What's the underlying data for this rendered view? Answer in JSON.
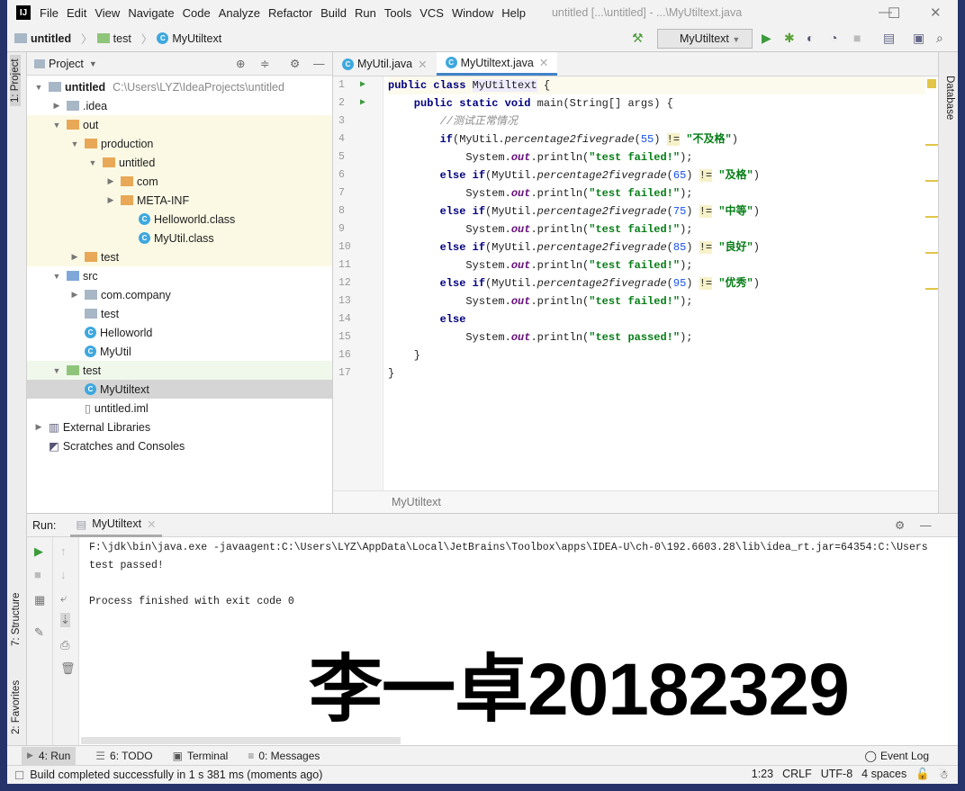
{
  "window": {
    "title": "untitled [...\\untitled] - ...\\MyUtiltext.java",
    "logo": "IJ"
  },
  "menu": [
    "File",
    "Edit",
    "View",
    "Navigate",
    "Code",
    "Analyze",
    "Refactor",
    "Build",
    "Run",
    "Tools",
    "VCS",
    "Window",
    "Help"
  ],
  "breadcrumb": [
    "untitled",
    "test",
    "MyUtiltext"
  ],
  "run_config": "MyUtiltext",
  "left_tabs": {
    "project": "1: Project",
    "structure": "7: Structure",
    "favorites": "2: Favorites"
  },
  "right_tabs": {
    "database": "Database"
  },
  "project": {
    "title": "Project",
    "tree": [
      {
        "label": "untitled",
        "path": "C:\\Users\\LYZ\\IdeaProjects\\untitled",
        "level": 0,
        "arrow": "open",
        "icon": "module",
        "bg": "",
        "bold": true
      },
      {
        "label": ".idea",
        "level": 1,
        "arrow": "closed",
        "icon": "folder",
        "bg": ""
      },
      {
        "label": "out",
        "level": 1,
        "arrow": "open",
        "icon": "folder-orange",
        "bg": "#fbf9e4"
      },
      {
        "label": "production",
        "level": 2,
        "arrow": "open",
        "icon": "folder-orange",
        "bg": "#fbf9e4"
      },
      {
        "label": "untitled",
        "level": 3,
        "arrow": "open",
        "icon": "folder-orange",
        "bg": "#fbf9e4"
      },
      {
        "label": "com",
        "level": 4,
        "arrow": "closed",
        "icon": "folder-orange",
        "bg": "#fbf9e4"
      },
      {
        "label": "META-INF",
        "level": 4,
        "arrow": "closed",
        "icon": "folder-orange",
        "bg": "#fbf9e4"
      },
      {
        "label": "Helloworld.class",
        "level": 5,
        "arrow": "",
        "icon": "class",
        "bg": "#fbf9e4"
      },
      {
        "label": "MyUtil.class",
        "level": 5,
        "arrow": "",
        "icon": "class",
        "bg": "#fbf9e4"
      },
      {
        "label": "test",
        "level": 2,
        "arrow": "closed",
        "icon": "folder-orange",
        "bg": "#fbf9e4"
      },
      {
        "label": "src",
        "level": 1,
        "arrow": "open",
        "icon": "folder-blue",
        "bg": ""
      },
      {
        "label": "com.company",
        "level": 2,
        "arrow": "closed",
        "icon": "folder",
        "bg": ""
      },
      {
        "label": "test",
        "level": 2,
        "arrow": "",
        "icon": "folder",
        "bg": ""
      },
      {
        "label": "Helloworld",
        "level": 2,
        "arrow": "",
        "icon": "class",
        "bg": ""
      },
      {
        "label": "MyUtil",
        "level": 2,
        "arrow": "",
        "icon": "class",
        "bg": ""
      },
      {
        "label": "test",
        "level": 1,
        "arrow": "open",
        "icon": "folder-green",
        "bg": "#eff8ea"
      },
      {
        "label": "MyUtiltext",
        "level": 2,
        "arrow": "",
        "icon": "class",
        "bg": "#d5d5d5"
      },
      {
        "label": "untitled.iml",
        "level": 2,
        "arrow": "",
        "icon": "file",
        "bg": ""
      },
      {
        "label": "External Libraries",
        "level": 0,
        "arrow": "closed",
        "icon": "library",
        "bg": ""
      },
      {
        "label": "Scratches and Consoles",
        "level": 0,
        "arrow": "",
        "icon": "scratch",
        "bg": ""
      }
    ]
  },
  "editor": {
    "tabs": [
      {
        "label": "MyUtil.java",
        "active": false
      },
      {
        "label": "MyUtiltext.java",
        "active": true
      }
    ],
    "footer_breadcrumb": "MyUtiltext",
    "lines": [
      [
        [
          "public class ",
          "kw"
        ],
        [
          "MyUtiltext",
          "cls"
        ],
        [
          " {",
          ""
        ]
      ],
      [
        [
          "    public static void ",
          "kw"
        ],
        [
          "main(String[] args) {",
          ""
        ]
      ],
      [
        [
          "        ",
          ""
        ],
        [
          "//测试正常情况",
          "cm"
        ]
      ],
      [
        [
          "        ",
          ""
        ],
        [
          "if",
          "kw"
        ],
        [
          "(MyUtil.",
          ""
        ],
        [
          "percentage2fivegrade",
          "it"
        ],
        [
          "(",
          ""
        ],
        [
          "55",
          "num"
        ],
        [
          ") ",
          ""
        ],
        [
          "!=",
          "hl"
        ],
        [
          " ",
          ""
        ],
        [
          "\"不及格\"",
          "st"
        ],
        [
          ")",
          ""
        ]
      ],
      [
        [
          "            System.",
          ""
        ],
        [
          "out",
          "fld"
        ],
        [
          ".println(",
          ""
        ],
        [
          "\"test failed!\"",
          "st"
        ],
        [
          ");",
          ""
        ]
      ],
      [
        [
          "        ",
          ""
        ],
        [
          "else if",
          "kw"
        ],
        [
          "(MyUtil.",
          ""
        ],
        [
          "percentage2fivegrade",
          "it"
        ],
        [
          "(",
          ""
        ],
        [
          "65",
          "num"
        ],
        [
          ") ",
          ""
        ],
        [
          "!=",
          "hl"
        ],
        [
          " ",
          ""
        ],
        [
          "\"及格\"",
          "st"
        ],
        [
          ")",
          ""
        ]
      ],
      [
        [
          "            System.",
          ""
        ],
        [
          "out",
          "fld"
        ],
        [
          ".println(",
          ""
        ],
        [
          "\"test failed!\"",
          "st"
        ],
        [
          ");",
          ""
        ]
      ],
      [
        [
          "        ",
          ""
        ],
        [
          "else if",
          "kw"
        ],
        [
          "(MyUtil.",
          ""
        ],
        [
          "percentage2fivegrade",
          "it"
        ],
        [
          "(",
          ""
        ],
        [
          "75",
          "num"
        ],
        [
          ") ",
          ""
        ],
        [
          "!=",
          "hl"
        ],
        [
          " ",
          ""
        ],
        [
          "\"中等\"",
          "st"
        ],
        [
          ")",
          ""
        ]
      ],
      [
        [
          "            System.",
          ""
        ],
        [
          "out",
          "fld"
        ],
        [
          ".println(",
          ""
        ],
        [
          "\"test failed!\"",
          "st"
        ],
        [
          ");",
          ""
        ]
      ],
      [
        [
          "        ",
          ""
        ],
        [
          "else if",
          "kw"
        ],
        [
          "(MyUtil.",
          ""
        ],
        [
          "percentage2fivegrade",
          "it"
        ],
        [
          "(",
          ""
        ],
        [
          "85",
          "num"
        ],
        [
          ") ",
          ""
        ],
        [
          "!=",
          "hl"
        ],
        [
          " ",
          ""
        ],
        [
          "\"良好\"",
          "st"
        ],
        [
          ")",
          ""
        ]
      ],
      [
        [
          "            System.",
          ""
        ],
        [
          "out",
          "fld"
        ],
        [
          ".println(",
          ""
        ],
        [
          "\"test failed!\"",
          "st"
        ],
        [
          ");",
          ""
        ]
      ],
      [
        [
          "        ",
          ""
        ],
        [
          "else if",
          "kw"
        ],
        [
          "(MyUtil.",
          ""
        ],
        [
          "percentage2fivegrade",
          "it"
        ],
        [
          "(",
          ""
        ],
        [
          "95",
          "num"
        ],
        [
          ") ",
          ""
        ],
        [
          "!=",
          "hl"
        ],
        [
          " ",
          ""
        ],
        [
          "\"优秀\"",
          "st"
        ],
        [
          ")",
          ""
        ]
      ],
      [
        [
          "            System.",
          ""
        ],
        [
          "out",
          "fld"
        ],
        [
          ".println(",
          ""
        ],
        [
          "\"test failed!\"",
          "st"
        ],
        [
          ");",
          ""
        ]
      ],
      [
        [
          "        ",
          ""
        ],
        [
          "else",
          "kw"
        ]
      ],
      [
        [
          "            System.",
          ""
        ],
        [
          "out",
          "fld"
        ],
        [
          ".println(",
          ""
        ],
        [
          "\"test passed!\"",
          "st"
        ],
        [
          ");",
          ""
        ]
      ],
      [
        [
          "    }",
          ""
        ]
      ],
      [
        [
          "}",
          ""
        ]
      ]
    ]
  },
  "run": {
    "label": "Run:",
    "tab": "MyUtiltext",
    "console": [
      "F:\\jdk\\bin\\java.exe -javaagent:C:\\Users\\LYZ\\AppData\\Local\\JetBrains\\Toolbox\\apps\\IDEA-U\\ch-0\\192.6603.28\\lib\\idea_rt.jar=64354:C:\\Users",
      "test passed!",
      "",
      "Process finished with exit code 0"
    ],
    "watermark": "李一卓20182329"
  },
  "bottom_tabs": [
    "4: Run",
    "6: TODO",
    "Terminal",
    "0: Messages"
  ],
  "event_log": "Event Log",
  "status": {
    "message": "Build completed successfully in 1 s 381 ms (moments ago)",
    "position": "1:23",
    "line_sep": "CRLF",
    "encoding": "UTF-8",
    "indent": "4 spaces"
  }
}
